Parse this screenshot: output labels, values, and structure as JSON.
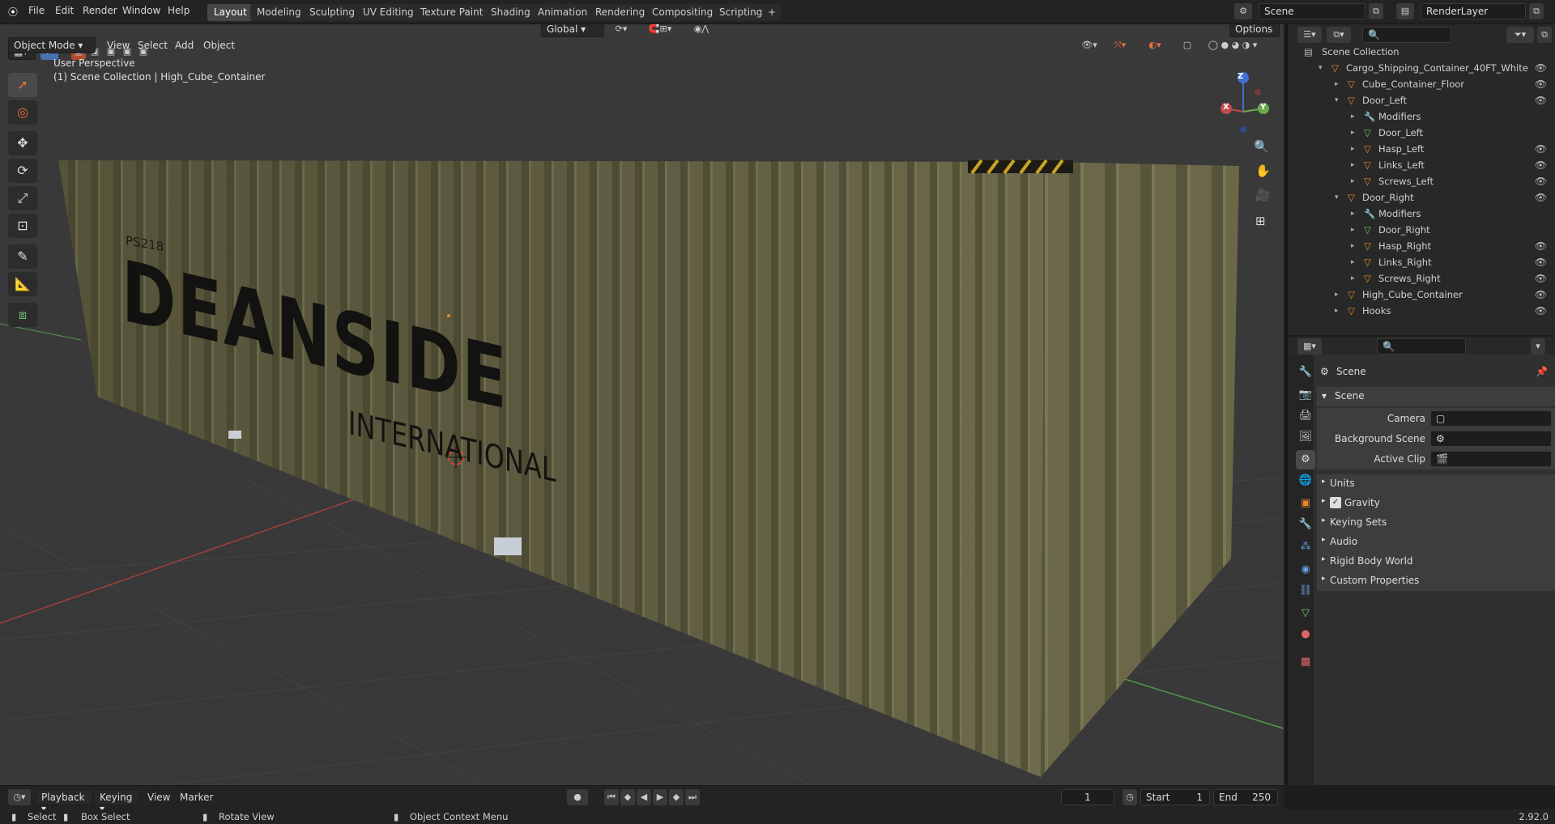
{
  "topbar": {
    "menus": [
      "File",
      "Edit",
      "Render",
      "Window",
      "Help"
    ],
    "workspaces": [
      "Layout",
      "Modeling",
      "Sculpting",
      "UV Editing",
      "Texture Paint",
      "Shading",
      "Animation",
      "Rendering",
      "Compositing",
      "Scripting"
    ],
    "active_workspace": "Layout",
    "add_tab": "+",
    "scene_name": "Scene",
    "view_layer": "RenderLayer"
  },
  "viewport": {
    "mode": "Object Mode",
    "menus": [
      "View",
      "Select",
      "Add",
      "Object"
    ],
    "orientation": "Global",
    "options": "Options",
    "overlay_title": "User Perspective",
    "overlay_subtitle": "(1) Scene Collection | High_Cube_Container",
    "container_text_1": "DEANSIDE",
    "container_text_2": "INTERNATIONAL",
    "container_code": "PS218",
    "gizmo_x": "X",
    "gizmo_y": "Y",
    "gizmo_z": "Z"
  },
  "outliner": {
    "root": "Scene Collection",
    "items": [
      {
        "label": "Cargo_Shipping_Container_40FT_White",
        "indent": 1
      },
      {
        "label": "Cube_Container_Floor",
        "indent": 2
      },
      {
        "label": "Door_Left",
        "indent": 2
      },
      {
        "label": "Modifiers",
        "indent": 3
      },
      {
        "label": "Door_Left",
        "indent": 3
      },
      {
        "label": "Hasp_Left",
        "indent": 3
      },
      {
        "label": "Links_Left",
        "indent": 3
      },
      {
        "label": "Screws_Left",
        "indent": 3
      },
      {
        "label": "Door_Right",
        "indent": 2
      },
      {
        "label": "Modifiers",
        "indent": 3
      },
      {
        "label": "Door_Right",
        "indent": 3
      },
      {
        "label": "Hasp_Right",
        "indent": 3
      },
      {
        "label": "Links_Right",
        "indent": 3
      },
      {
        "label": "Screws_Right",
        "indent": 3
      },
      {
        "label": "High_Cube_Container",
        "indent": 2
      },
      {
        "label": "Hooks",
        "indent": 2
      }
    ]
  },
  "properties": {
    "context_title": "Scene",
    "panel_title": "Scene",
    "camera_label": "Camera",
    "background_scene_label": "Background Scene",
    "active_clip_label": "Active Clip",
    "subpanels": [
      "Units",
      "Gravity",
      "Keying Sets",
      "Audio",
      "Rigid Body World",
      "Custom Properties"
    ]
  },
  "timeline": {
    "playback": "Playback",
    "keying": "Keying",
    "view": "View",
    "marker": "Marker",
    "current_frame": "1",
    "start_label": "Start",
    "start": "1",
    "end_label": "End",
    "end": "250"
  },
  "statusbar": {
    "select": "Select",
    "box_select": "Box Select",
    "rotate_view": "Rotate View",
    "context_menu": "Object Context Menu",
    "version": "2.92.0"
  },
  "colors": {
    "accent": "#4772b3",
    "object_orange": "#e8892c",
    "mesh_green": "#6fc86f"
  }
}
